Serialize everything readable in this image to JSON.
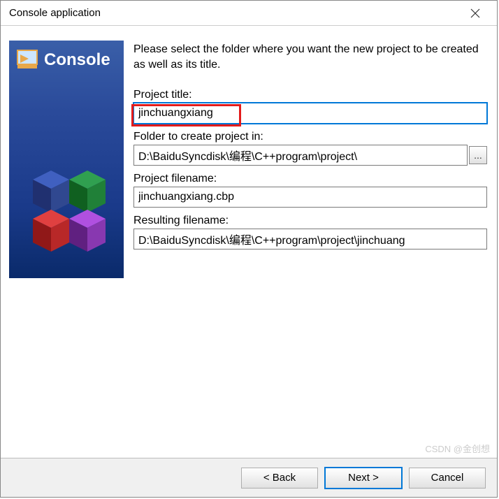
{
  "window_title": "Console application",
  "sidebar": {
    "banner": "Console"
  },
  "instructions": "Please select the folder where you want the new project to be created as well as its title.",
  "form": {
    "project_title": {
      "label": "Project title:",
      "value": "jinchuangxiang"
    },
    "folder": {
      "label": "Folder to create project in:",
      "value": "D:\\BaiduSyncdisk\\编程\\C++program\\project\\"
    },
    "filename": {
      "label": "Project filename:",
      "value": "jinchuangxiang.cbp"
    },
    "resulting": {
      "label": "Resulting filename:",
      "value": "D:\\BaiduSyncdisk\\编程\\C++program\\project\\jinchuang"
    }
  },
  "buttons": {
    "browse": "...",
    "back": "< Back",
    "next": "Next >",
    "cancel": "Cancel"
  },
  "watermark": "CSDN @金创想"
}
